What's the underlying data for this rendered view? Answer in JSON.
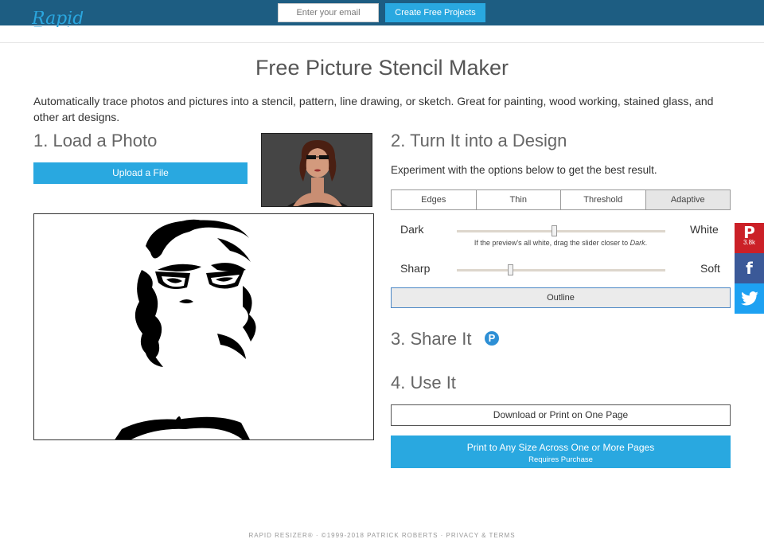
{
  "topbar": {
    "email_placeholder": "Enter your email",
    "cta_label": "Create Free Projects"
  },
  "logo": {
    "text": "Rapid Resizer"
  },
  "page_title": "Free Picture Stencil Maker",
  "intro": "Automatically trace photos and pictures into a stencil, pattern, line drawing, or sketch. Great for painting, wood working, stained glass, and other art designs.",
  "step1": {
    "heading": "1. Load a Photo",
    "upload_label": "Upload a File"
  },
  "step2": {
    "heading": "2. Turn It into a Design",
    "subtext": "Experiment with the options below to get the best result.",
    "tabs": [
      {
        "label": "Edges"
      },
      {
        "label": "Thin"
      },
      {
        "label": "Threshold"
      },
      {
        "label": "Adaptive",
        "active": true
      }
    ],
    "slider1": {
      "left_label": "Dark",
      "right_label": "White",
      "value": 0.47
    },
    "hint_prefix": "If the preview's all white, drag the slider closer to ",
    "hint_emph": "Dark",
    "hint_suffix": ".",
    "slider2": {
      "left_label": "Sharp",
      "right_label": "Soft",
      "value": 0.25
    },
    "outline_label": "Outline"
  },
  "step3": {
    "heading": "3. Share It",
    "pinterest_icon": "pinterest-icon"
  },
  "step4": {
    "heading": "4. Use It",
    "download_label": "Download or Print on One Page",
    "print_label": "Print to Any Size Across One or More Pages",
    "print_sub": "Requires Purchase"
  },
  "social": {
    "pinterest_count": "3.8k",
    "colors": {
      "pinterest": "#cb2027",
      "facebook": "#3b5998",
      "twitter": "#1da1f2"
    }
  },
  "footer": "RAPID RESIZER®  ·  ©1999-2018 PATRICK ROBERTS  ·  PRIVACY & TERMS",
  "colors": {
    "topbar": "#1d5d82",
    "accent": "#29a8e0"
  }
}
